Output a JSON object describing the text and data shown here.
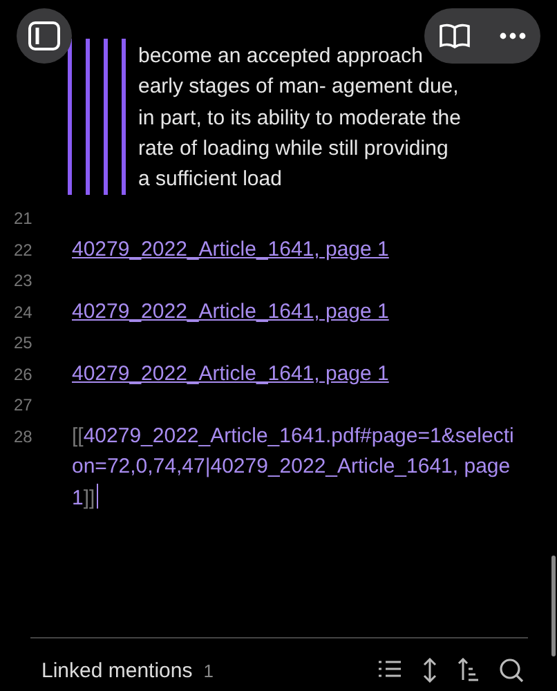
{
  "quote": {
    "quote": {
      "quote": {
        "quote": {
          "text": "become an accepted approach early stages of man- agement due, in part, to its ability to moderate the rate of loading while still providing a sufficient load"
        }
      }
    }
  },
  "lines": [
    {
      "number": "21",
      "kind": "blank"
    },
    {
      "number": "22",
      "kind": "link",
      "text": "40279_2022_Article_1641, page 1"
    },
    {
      "number": "23",
      "kind": "blank"
    },
    {
      "number": "24",
      "kind": "link",
      "text": "40279_2022_Article_1641, page 1"
    },
    {
      "number": "25",
      "kind": "blank"
    },
    {
      "number": "26",
      "kind": "link",
      "text": "40279_2022_Article_1641, page 1"
    },
    {
      "number": "27",
      "kind": "blank"
    },
    {
      "number": "28",
      "kind": "raw",
      "open": "[[",
      "text": "40279_2022_Article_1641.pdf#page=1&selection=72,0,74,47|40279_2022_Article_1641, page 1",
      "close": "]]",
      "cursor": true
    }
  ],
  "footer": {
    "label": "Linked mentions",
    "count": "1"
  }
}
